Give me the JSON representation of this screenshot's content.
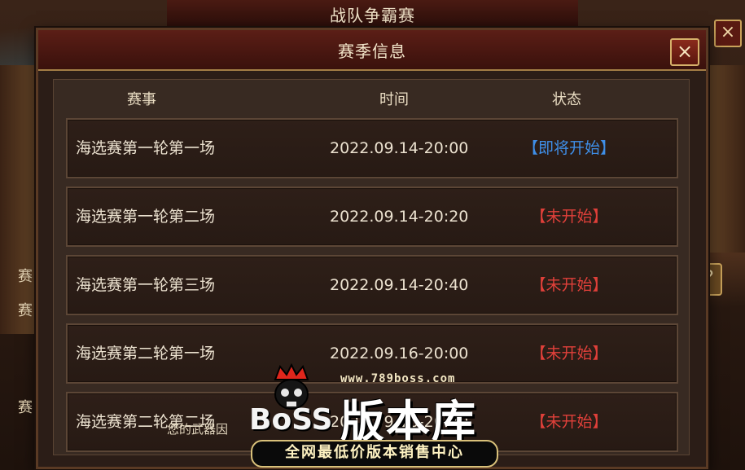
{
  "outer_window": {
    "title": "战队争霸赛",
    "side_letters": [
      "赛",
      "赛",
      "赛"
    ]
  },
  "modal": {
    "title": "赛季信息",
    "close_icon": "×",
    "columns": {
      "event": "赛事",
      "time": "时间",
      "status": "状态"
    },
    "rows": [
      {
        "event": "海选赛第一轮第一场",
        "time": "2022.09.14-20:00",
        "status": "【即将开始】",
        "status_color": "#3f8fe8"
      },
      {
        "event": "海选赛第一轮第二场",
        "time": "2022.09.14-20:20",
        "status": "【未开始】",
        "status_color": "#e0403a"
      },
      {
        "event": "海选赛第一轮第三场",
        "time": "2022.09.14-20:40",
        "status": "【未开始】",
        "status_color": "#e0403a"
      },
      {
        "event": "海选赛第二轮第一场",
        "time": "2022.09.16-20:00",
        "status": "【未开始】",
        "status_color": "#e0403a"
      },
      {
        "event": "海选赛第二轮第二场",
        "time": "2022.09.16-20:20",
        "status": "【未开始】",
        "status_color": "#e0403a"
      }
    ]
  },
  "notice": "您的武器因",
  "watermark": {
    "url": "www.789boss.com",
    "brand": "BoSS",
    "name": "版本库",
    "slogan": "全网最低价版本销售中心"
  }
}
